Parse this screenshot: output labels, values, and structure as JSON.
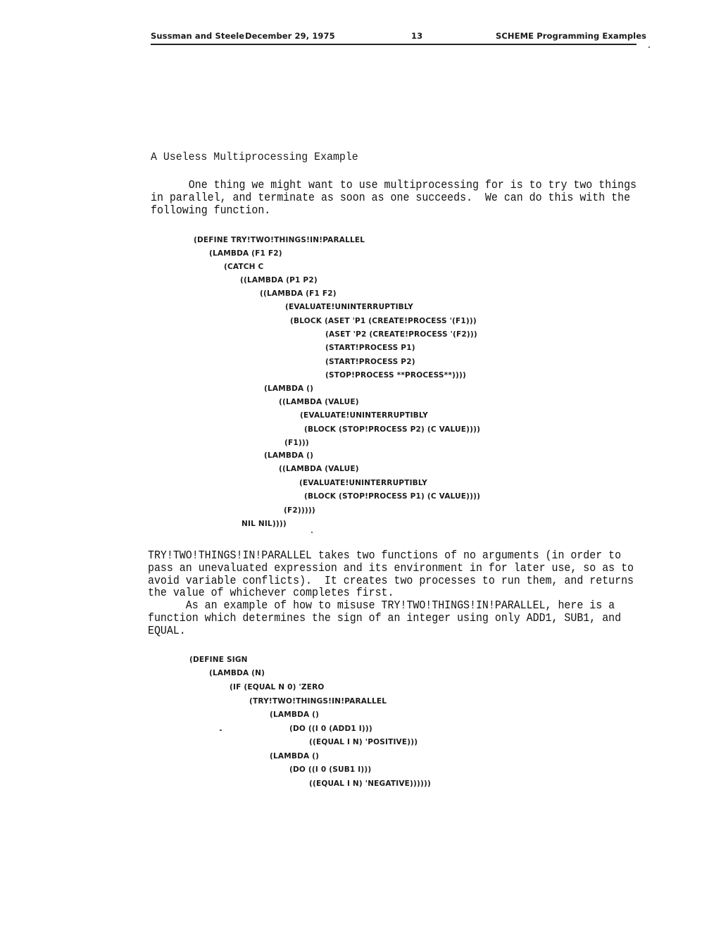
{
  "header": {
    "authors": "Sussman and Steele",
    "date": "December 29, 1975",
    "page_number": "13",
    "section": "SCHEME Programming Examples"
  },
  "section_heading": "A Useless Multiprocessing Example",
  "paragraph1": {
    "lines": [
      "      One thing we might want to use multiprocessing for is to try two things",
      "in parallel, and terminate as soon as one succeeds.  We can do this with the",
      "following function."
    ]
  },
  "code1": {
    "lines": [
      "(DEFINE TRY!TWO!THINGS!IN!PARALLEL",
      "(LAMBDA (F1 F2)",
      "(CATCH C",
      "((LAMBDA (P1 P2)",
      "((LAMBDA (F1 F2)",
      "(EVALUATE!UNINTERRUPTIBLY",
      "(BLOCK (ASET 'P1 (CREATE!PROCESS '(F1)))",
      "(ASET 'P2 (CREATE!PROCESS '(F2)))",
      "(START!PROCESS P1)",
      "(START!PROCESS P2)",
      "(STOP!PROCESS **PROCESS**))))",
      "(LAMBDA ()",
      "((LAMBDA (VALUE)",
      "(EVALUATE!UNINTERRUPTIBLY",
      "(BLOCK (STOP!PROCESS P2) (C VALUE))))",
      "(F1)))",
      "(LAMBDA ()",
      "((LAMBDA (VALUE)",
      "(EVALUATE!UNINTERRUPTIBLY",
      "(BLOCK (STOP!PROCESS P1) (C VALUE))))",
      "(F2)))))",
      "NIL NIL))))"
    ]
  },
  "paragraph2": {
    "lines": [
      "TRY!TWO!THINGS!IN!PARALLEL takes two functions of no arguments (in order to",
      "pass an unevaluated expression and its environment in for later use, so as to",
      "avoid variable conflicts).  It creates two processes to run them, and returns",
      "the value of whichever completes first.",
      "      As an example of how to misuse TRY!TWO!THINGS!IN!PARALLEL, here is a",
      "function which determines the sign of an integer using only ADD1, SUB1, and",
      "EQUAL."
    ]
  },
  "code2": {
    "lines": [
      "(DEFINE SIGN",
      "(LAMBDA (N)",
      "(IF (EQUAL N 0) 'ZERO",
      "(TRY!TWO!THINGS!IN!PARALLEL",
      "(LAMBDA ()",
      "(DO ((I 0 (ADD1 I)))",
      "((EQUAL I N) 'POSITIVE)))",
      "(LAMBDA ()",
      "(DO ((I 0 (SUB1 I)))",
      "((EQUAL I N) 'NEGATIVE))))))"
    ]
  }
}
